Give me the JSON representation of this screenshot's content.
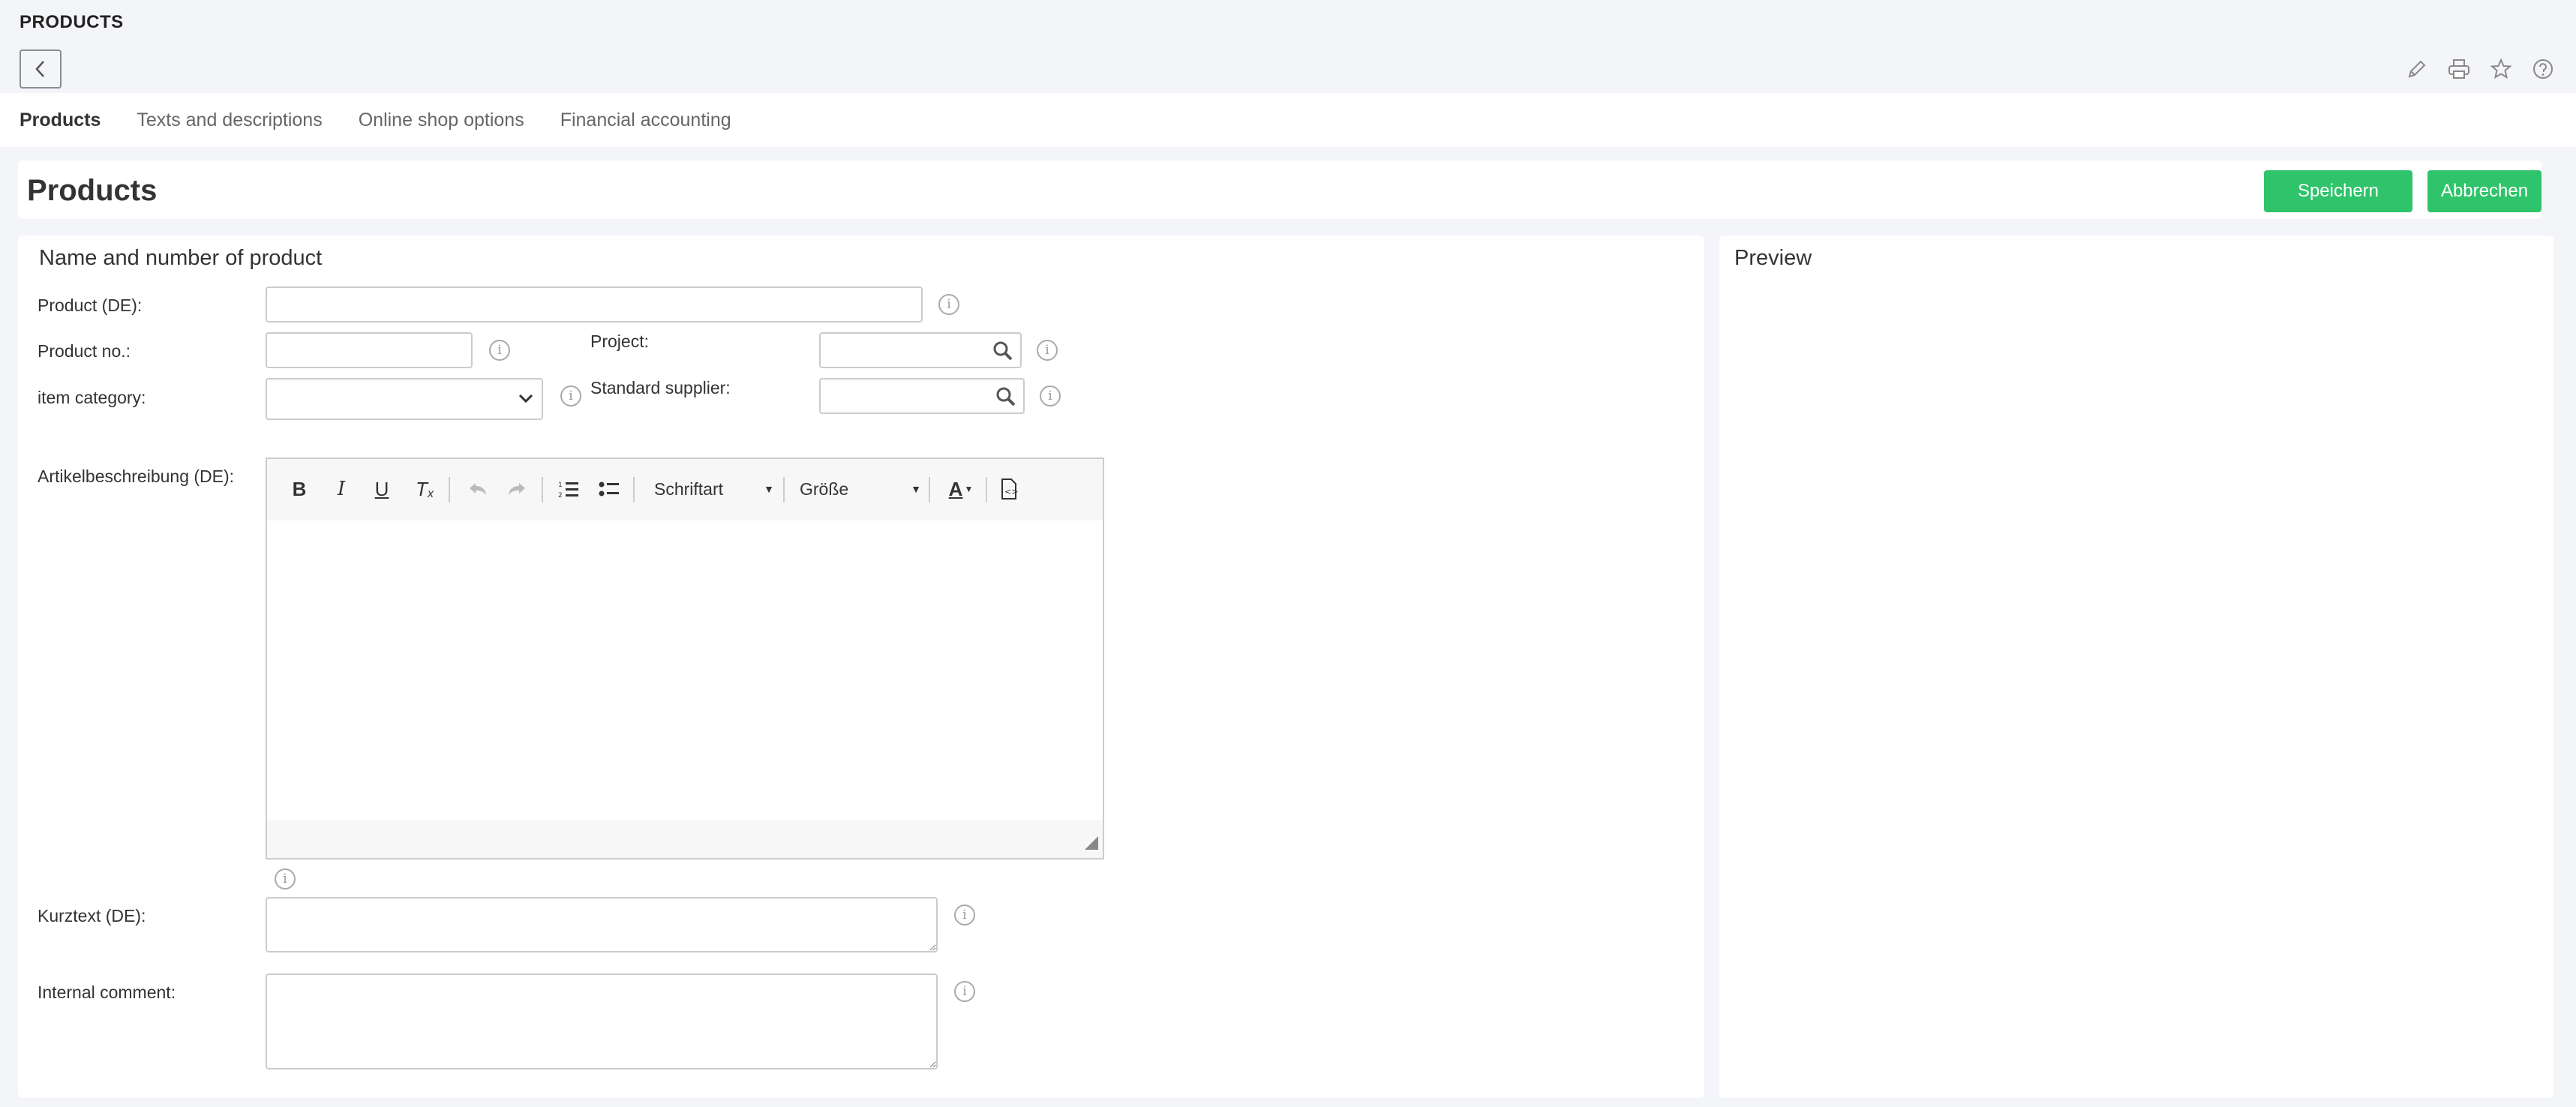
{
  "app": {
    "title": "PRODUCTS"
  },
  "header_icons": [
    "pencil-icon",
    "printer-icon",
    "star-icon",
    "help-icon"
  ],
  "tabs": [
    {
      "label": "Products",
      "active": true
    },
    {
      "label": "Texts and descriptions",
      "active": false
    },
    {
      "label": "Online shop options",
      "active": false
    },
    {
      "label": "Financial accounting",
      "active": false
    }
  ],
  "page": {
    "title": "Products",
    "save_label": "Speichern",
    "cancel_label": "Abbrechen"
  },
  "form": {
    "section_title": "Name and number of product",
    "product_label": "Product (DE):",
    "product_value": "",
    "product_no_label": "Product no.:",
    "product_no_value": "",
    "item_category_label": "item category:",
    "item_category_value": "",
    "project_label": "Project:",
    "project_value": "",
    "standard_supplier_label": "Standard supplier:",
    "standard_supplier_value": "",
    "description_label": "Artikelbeschreibung (DE):",
    "editor": {
      "font_dropdown": "Schriftart",
      "size_dropdown": "Größe",
      "content": ""
    },
    "short_text_label": "Kurztext (DE):",
    "short_text_value": "",
    "internal_comment_label": "Internal comment:",
    "internal_comment_value": ""
  },
  "preview": {
    "title": "Preview"
  },
  "colors": {
    "accent_green": "#2fc46b",
    "background": "#f4f5f9",
    "panel": "#ffffff"
  }
}
